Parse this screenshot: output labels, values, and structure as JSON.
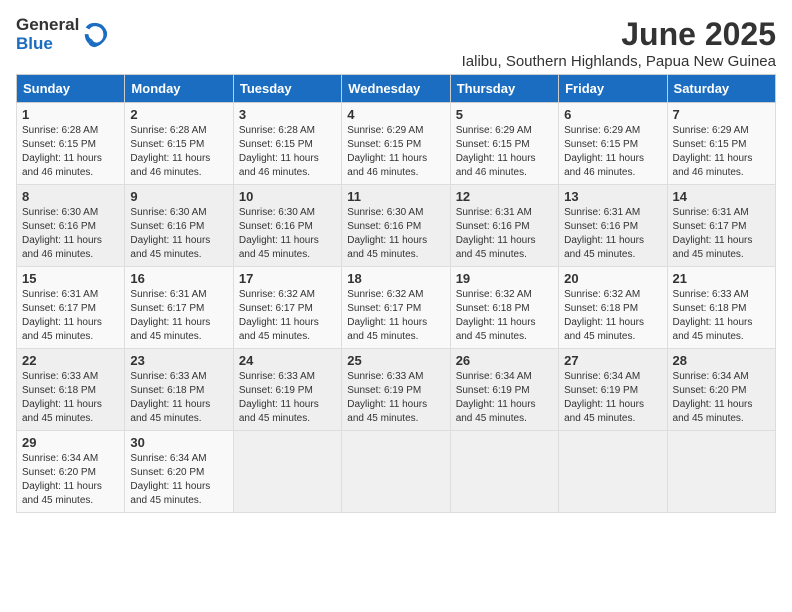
{
  "header": {
    "logo_general": "General",
    "logo_blue": "Blue",
    "title": "June 2025",
    "subtitle": "Ialibu, Southern Highlands, Papua New Guinea"
  },
  "weekdays": [
    "Sunday",
    "Monday",
    "Tuesday",
    "Wednesday",
    "Thursday",
    "Friday",
    "Saturday"
  ],
  "weeks": [
    [
      {
        "day": "1",
        "sunrise": "6:28 AM",
        "sunset": "6:15 PM",
        "daylight": "11 hours and 46 minutes."
      },
      {
        "day": "2",
        "sunrise": "6:28 AM",
        "sunset": "6:15 PM",
        "daylight": "11 hours and 46 minutes."
      },
      {
        "day": "3",
        "sunrise": "6:28 AM",
        "sunset": "6:15 PM",
        "daylight": "11 hours and 46 minutes."
      },
      {
        "day": "4",
        "sunrise": "6:29 AM",
        "sunset": "6:15 PM",
        "daylight": "11 hours and 46 minutes."
      },
      {
        "day": "5",
        "sunrise": "6:29 AM",
        "sunset": "6:15 PM",
        "daylight": "11 hours and 46 minutes."
      },
      {
        "day": "6",
        "sunrise": "6:29 AM",
        "sunset": "6:15 PM",
        "daylight": "11 hours and 46 minutes."
      },
      {
        "day": "7",
        "sunrise": "6:29 AM",
        "sunset": "6:15 PM",
        "daylight": "11 hours and 46 minutes."
      }
    ],
    [
      {
        "day": "8",
        "sunrise": "6:30 AM",
        "sunset": "6:16 PM",
        "daylight": "11 hours and 46 minutes."
      },
      {
        "day": "9",
        "sunrise": "6:30 AM",
        "sunset": "6:16 PM",
        "daylight": "11 hours and 45 minutes."
      },
      {
        "day": "10",
        "sunrise": "6:30 AM",
        "sunset": "6:16 PM",
        "daylight": "11 hours and 45 minutes."
      },
      {
        "day": "11",
        "sunrise": "6:30 AM",
        "sunset": "6:16 PM",
        "daylight": "11 hours and 45 minutes."
      },
      {
        "day": "12",
        "sunrise": "6:31 AM",
        "sunset": "6:16 PM",
        "daylight": "11 hours and 45 minutes."
      },
      {
        "day": "13",
        "sunrise": "6:31 AM",
        "sunset": "6:16 PM",
        "daylight": "11 hours and 45 minutes."
      },
      {
        "day": "14",
        "sunrise": "6:31 AM",
        "sunset": "6:17 PM",
        "daylight": "11 hours and 45 minutes."
      }
    ],
    [
      {
        "day": "15",
        "sunrise": "6:31 AM",
        "sunset": "6:17 PM",
        "daylight": "11 hours and 45 minutes."
      },
      {
        "day": "16",
        "sunrise": "6:31 AM",
        "sunset": "6:17 PM",
        "daylight": "11 hours and 45 minutes."
      },
      {
        "day": "17",
        "sunrise": "6:32 AM",
        "sunset": "6:17 PM",
        "daylight": "11 hours and 45 minutes."
      },
      {
        "day": "18",
        "sunrise": "6:32 AM",
        "sunset": "6:17 PM",
        "daylight": "11 hours and 45 minutes."
      },
      {
        "day": "19",
        "sunrise": "6:32 AM",
        "sunset": "6:18 PM",
        "daylight": "11 hours and 45 minutes."
      },
      {
        "day": "20",
        "sunrise": "6:32 AM",
        "sunset": "6:18 PM",
        "daylight": "11 hours and 45 minutes."
      },
      {
        "day": "21",
        "sunrise": "6:33 AM",
        "sunset": "6:18 PM",
        "daylight": "11 hours and 45 minutes."
      }
    ],
    [
      {
        "day": "22",
        "sunrise": "6:33 AM",
        "sunset": "6:18 PM",
        "daylight": "11 hours and 45 minutes."
      },
      {
        "day": "23",
        "sunrise": "6:33 AM",
        "sunset": "6:18 PM",
        "daylight": "11 hours and 45 minutes."
      },
      {
        "day": "24",
        "sunrise": "6:33 AM",
        "sunset": "6:19 PM",
        "daylight": "11 hours and 45 minutes."
      },
      {
        "day": "25",
        "sunrise": "6:33 AM",
        "sunset": "6:19 PM",
        "daylight": "11 hours and 45 minutes."
      },
      {
        "day": "26",
        "sunrise": "6:34 AM",
        "sunset": "6:19 PM",
        "daylight": "11 hours and 45 minutes."
      },
      {
        "day": "27",
        "sunrise": "6:34 AM",
        "sunset": "6:19 PM",
        "daylight": "11 hours and 45 minutes."
      },
      {
        "day": "28",
        "sunrise": "6:34 AM",
        "sunset": "6:20 PM",
        "daylight": "11 hours and 45 minutes."
      }
    ],
    [
      {
        "day": "29",
        "sunrise": "6:34 AM",
        "sunset": "6:20 PM",
        "daylight": "11 hours and 45 minutes."
      },
      {
        "day": "30",
        "sunrise": "6:34 AM",
        "sunset": "6:20 PM",
        "daylight": "11 hours and 45 minutes."
      },
      null,
      null,
      null,
      null,
      null
    ]
  ]
}
